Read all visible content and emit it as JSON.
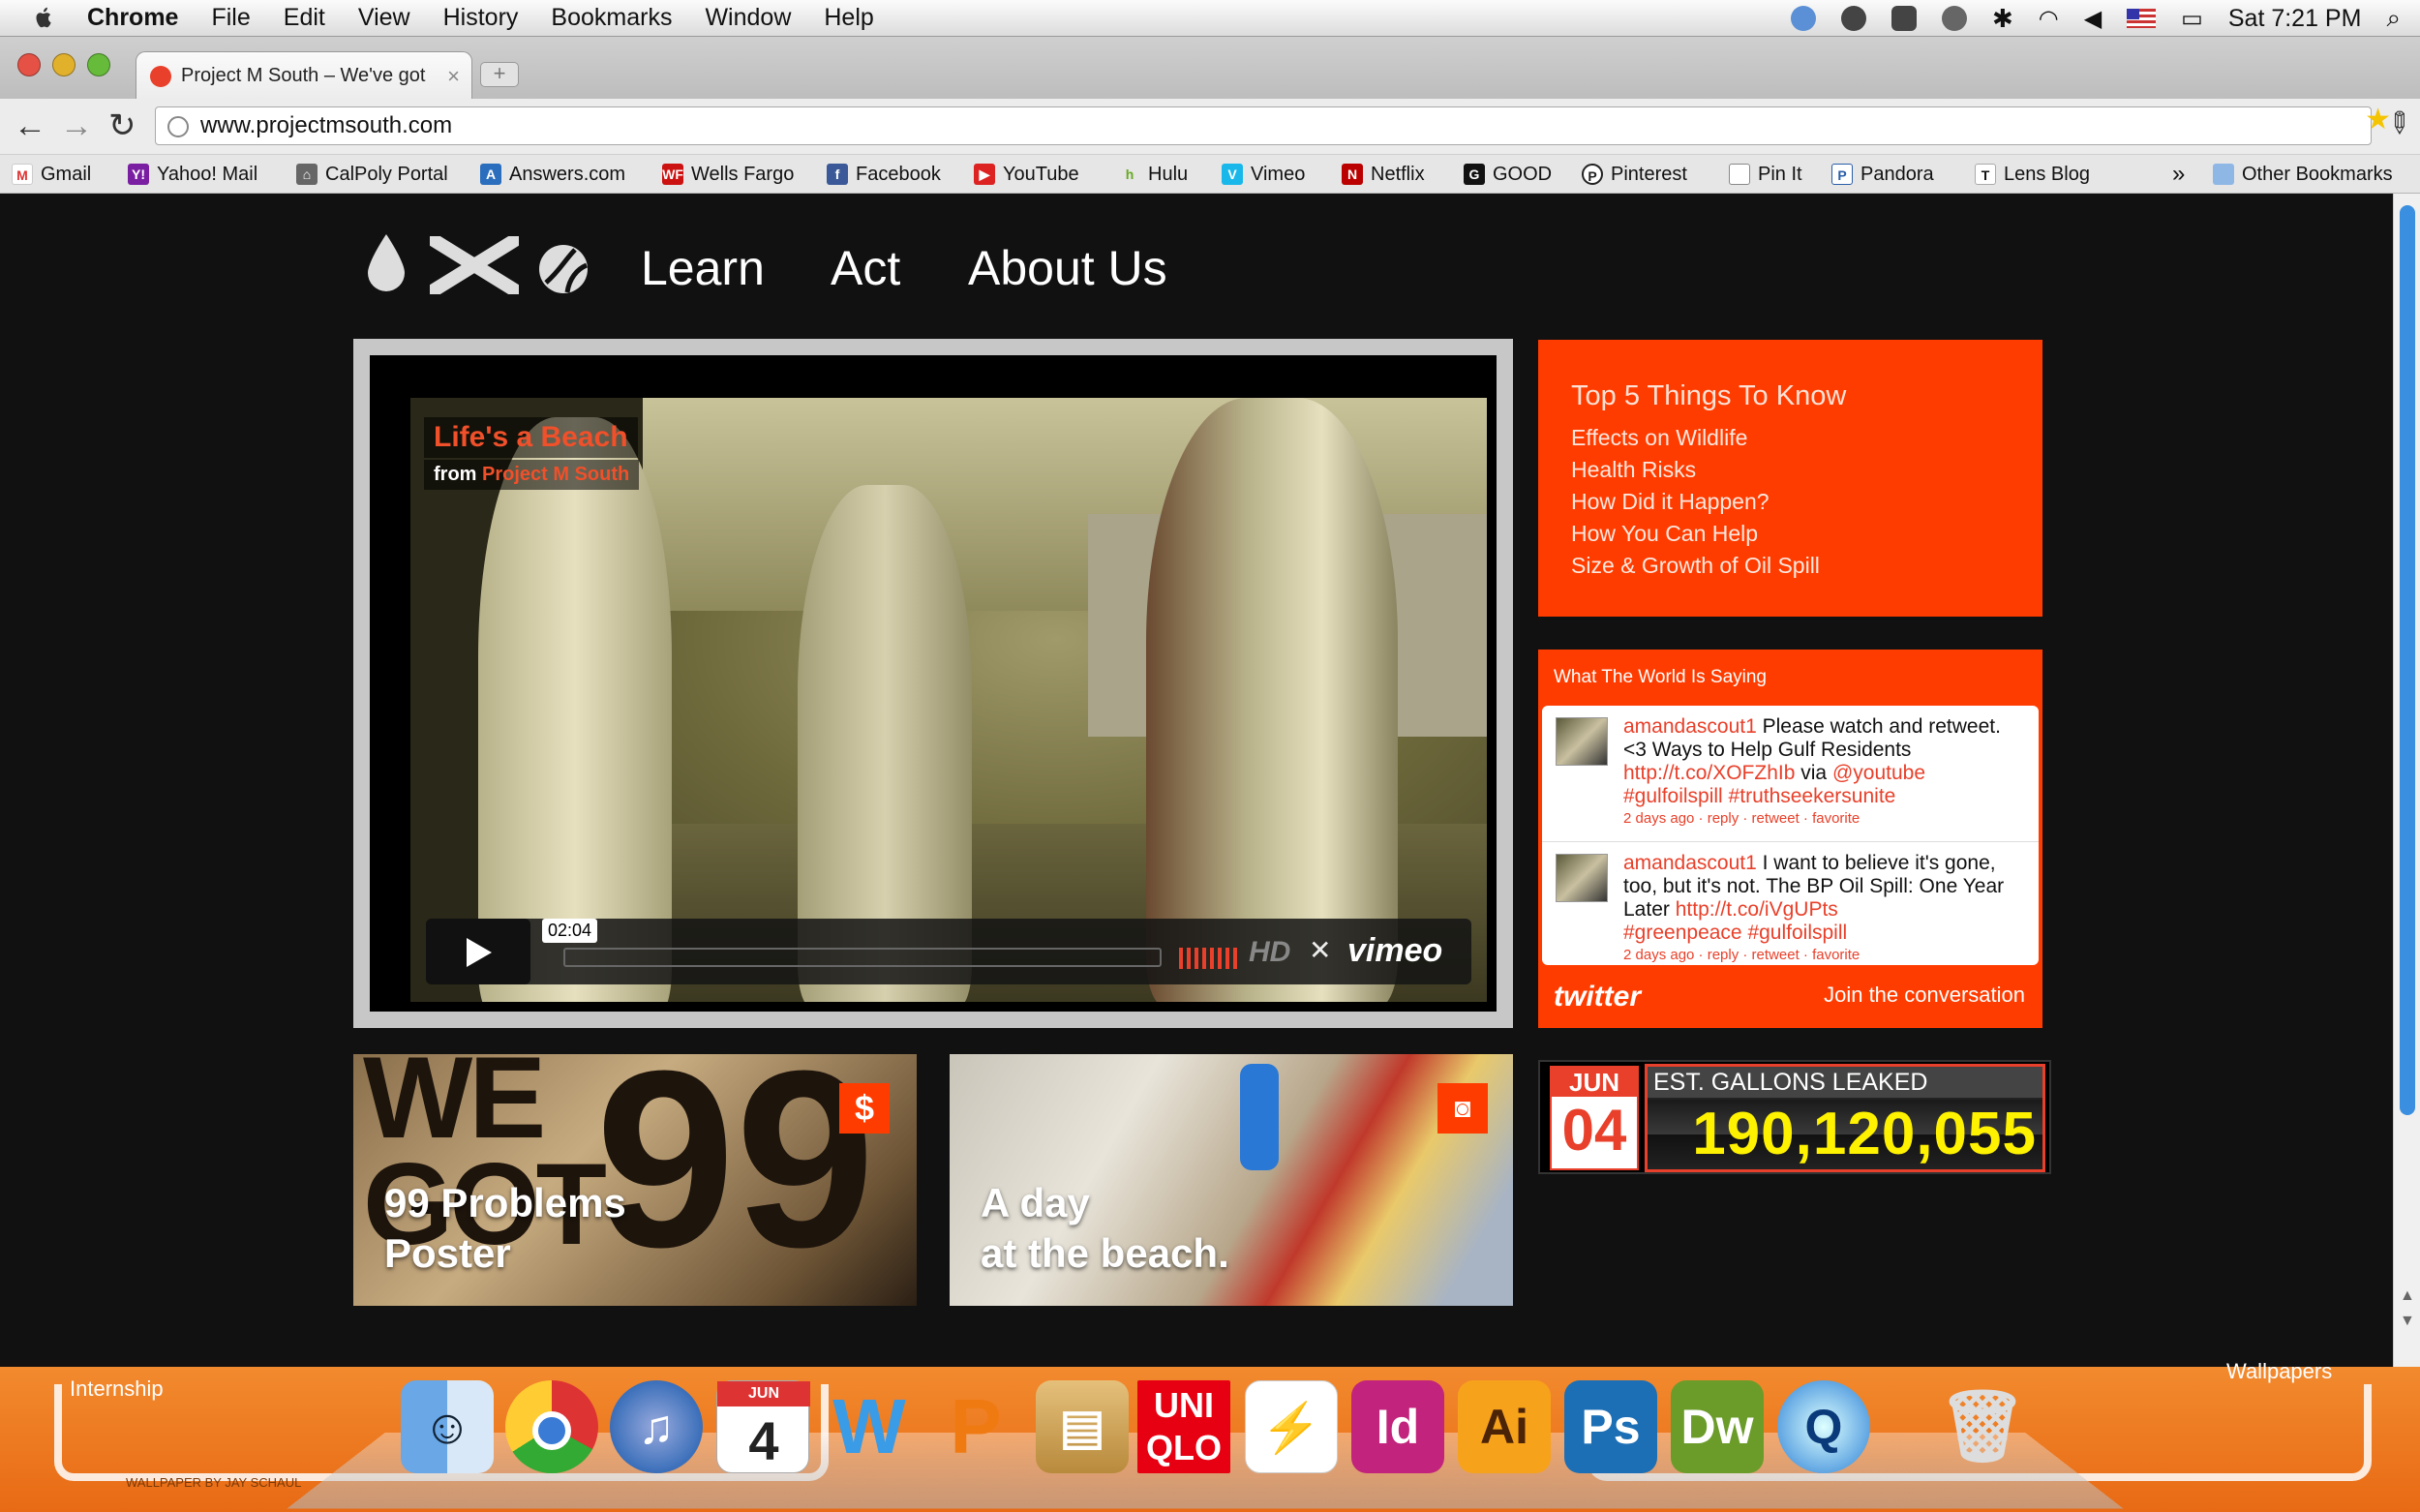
{
  "menubar": {
    "items": [
      "Chrome",
      "File",
      "Edit",
      "View",
      "History",
      "Bookmarks",
      "Window",
      "Help"
    ],
    "clock": "Sat 7:21 PM"
  },
  "tab": {
    "title": "Project M South – We've got",
    "close": "×",
    "new_tab": "+"
  },
  "toolbar": {
    "url": "www.projectmsouth.com"
  },
  "bookmarks": {
    "items": [
      "Gmail",
      "Yahoo! Mail",
      "CalPoly Portal",
      "Answers.com",
      "Wells Fargo",
      "Facebook",
      "YouTube",
      "Hulu",
      "Vimeo",
      "Netflix",
      "GOOD",
      "Pinterest",
      "Pin It",
      "Pandora",
      "Lens Blog"
    ],
    "overflow": "»",
    "other": "Other Bookmarks"
  },
  "nav": {
    "learn": "Learn",
    "act": "Act",
    "about": "About Us"
  },
  "video": {
    "title": "Life's a Beach",
    "from_label": "from",
    "from_name": "Project M South",
    "time": "02:04",
    "hd": "HD",
    "brand": "vimeo",
    "progress": 0
  },
  "top5": {
    "heading": "Top 5 Things To Know",
    "items": [
      "Effects on Wildlife",
      "Health Risks",
      "How Did it Happen?",
      "How You Can Help",
      "Size & Growth of Oil Spill"
    ]
  },
  "twitter": {
    "heading": "What The World Is Saying",
    "tweets": [
      {
        "user": "amandascout1",
        "text1": "Please watch and retweet. <3 Ways to Help Gulf Residents",
        "link": "http://t.co/XOFZhIb",
        "via": "via",
        "mention": "@youtube",
        "tags": "#gulfoilspill #truthseekersunite",
        "meta": "2 days ago · reply · retweet · favorite"
      },
      {
        "user": "amandascout1",
        "text1": "I want to believe it's gone, too, but it's not. The BP Oil Spill: One Year Later",
        "link": "http://t.co/iVgUPts",
        "via": "",
        "mention": "",
        "tags": "#greenpeace #gulfoilspill",
        "meta": "2 days ago · reply · retweet · favorite"
      }
    ],
    "logo": "twitter",
    "join": "Join the conversation"
  },
  "counter": {
    "month": "JUN",
    "day": "04",
    "label": "EST. GALLONS LEAKED",
    "value": "190,120,055"
  },
  "tiles": [
    {
      "caption1": "99 Problems",
      "caption2": "Poster",
      "badge": "$"
    },
    {
      "caption1": "A day",
      "caption2": "at the beach."
    }
  ],
  "dock": {
    "left_label": "Internship",
    "right_label": "Wallpapers",
    "credit": "WALLPAPER BY JAY SCHAUL",
    "ical_month": "JUN",
    "ical_day": "4",
    "apps": [
      "Finder",
      "Chrome",
      "iTunes",
      "iCal",
      "Word",
      "PowerPoint",
      "Keynote",
      "UNIQLO",
      "Acrobat",
      "InDesign",
      "Illustrator",
      "Photoshop",
      "Dreamweaver",
      "QuickTime",
      "Trash"
    ],
    "uniqlo_label": "UNI QLO",
    "id_label": "Id",
    "ai_label": "Ai",
    "ps_label": "Ps",
    "dw_label": "Dw"
  }
}
